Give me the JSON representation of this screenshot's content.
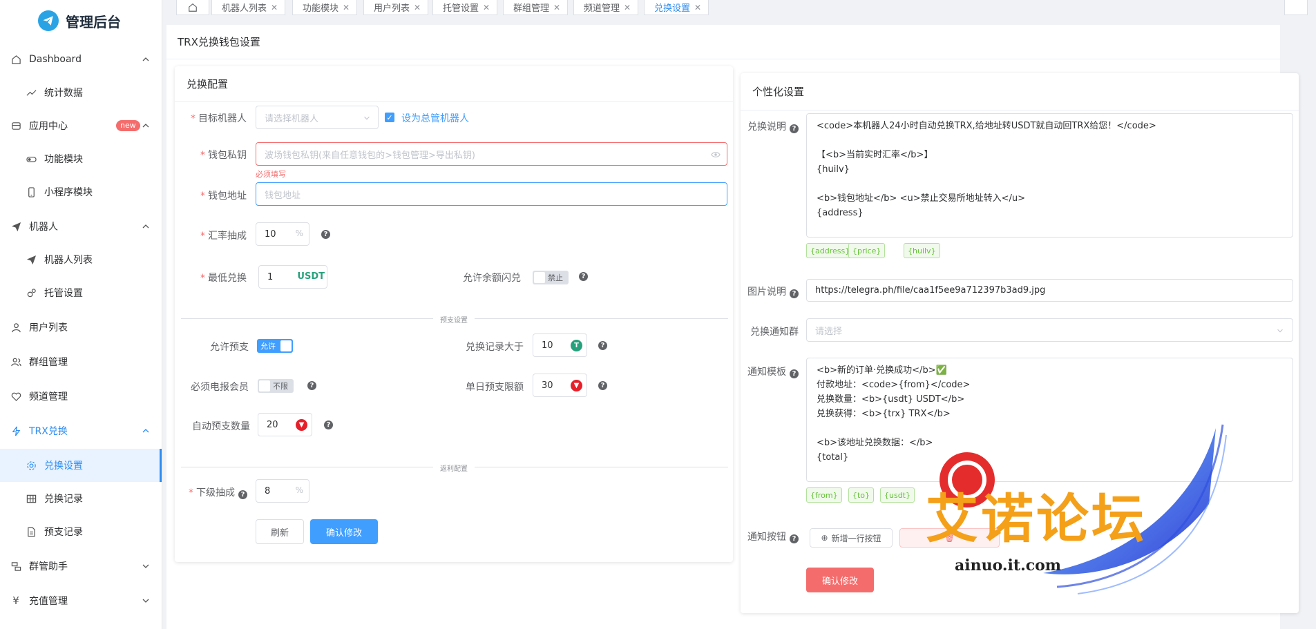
{
  "app": {
    "title": "管理后台"
  },
  "sidebar": {
    "items": [
      {
        "label": "Dashboard",
        "icon": "home-icon"
      },
      {
        "label": "统计数据",
        "icon": "trend-icon"
      },
      {
        "label": "应用中心",
        "icon": "app-center-icon",
        "badge": "new"
      },
      {
        "label": "功能模块",
        "icon": "toggle-icon"
      },
      {
        "label": "小程序模块",
        "icon": "phone-icon"
      },
      {
        "label": "机器人",
        "icon": "send-icon"
      },
      {
        "label": "机器人列表",
        "icon": "send-icon"
      },
      {
        "label": "托管设置",
        "icon": "gears-icon"
      },
      {
        "label": "用户列表",
        "icon": "user-icon"
      },
      {
        "label": "群组管理",
        "icon": "group-icon"
      },
      {
        "label": "频道管理",
        "icon": "heart-icon"
      },
      {
        "label": "TRX兑换",
        "icon": "bolt-icon"
      },
      {
        "label": "兑换设置",
        "icon": "gear-icon"
      },
      {
        "label": "兑换记录",
        "icon": "grid-icon"
      },
      {
        "label": "预支记录",
        "icon": "doc-icon"
      },
      {
        "label": "群管助手",
        "icon": "manage-icon"
      },
      {
        "label": "充值管理",
        "icon": "yen-icon"
      }
    ]
  },
  "tabs": [
    {
      "label": "机器人列表"
    },
    {
      "label": "功能模块"
    },
    {
      "label": "用户列表"
    },
    {
      "label": "托管设置"
    },
    {
      "label": "群组管理"
    },
    {
      "label": "频道管理"
    },
    {
      "label": "兑换设置",
      "active": true
    }
  ],
  "page": {
    "title": "TRX兑换钱包设置"
  },
  "left_card": {
    "title": "兑换配置",
    "target_bot": {
      "label": "目标机器人",
      "placeholder": "请选择机器人",
      "checkbox_label": "设为总管机器人"
    },
    "private_key": {
      "label": "钱包私钥",
      "placeholder": "波场钱包私钥(来自任意钱包的>钱包管理>导出私钥)",
      "error": "必须填写"
    },
    "address": {
      "label": "钱包地址",
      "placeholder": "钱包地址"
    },
    "rate_fee": {
      "label": "汇率抽成",
      "value": "10",
      "suffix": "%"
    },
    "min_exchange": {
      "label": "最低兑换",
      "value": "1",
      "suffix": "USDT"
    },
    "allow_flash": {
      "label": "允许余额闪兑",
      "switch_text": "禁止"
    },
    "divider1": "预支设置",
    "allow_advance": {
      "label": "允许预支",
      "switch_text": "允许"
    },
    "record_gt": {
      "label": "兑换记录大于",
      "value": "10"
    },
    "must_premium": {
      "label": "必须电报会员",
      "switch_text": "不限"
    },
    "daily_limit": {
      "label": "单日预支限额",
      "value": "30"
    },
    "auto_amount": {
      "label": "自动预支数量",
      "value": "20"
    },
    "divider2": "返利配置",
    "sub_fee": {
      "label": "下级抽成",
      "value": "8",
      "suffix": "%"
    },
    "refresh_btn": "刷新",
    "confirm_btn": "确认修改"
  },
  "right_card": {
    "title": "个性化设置",
    "exchange_desc": {
      "label": "兑换说明",
      "value": "<code>本机器人24小时自动兑换TRX,给地址转USDT就自动回TRX给您！</code>\n\n【<b>当前实时汇率</b>】\n{huilv}\n\n<b>钱包地址</b> <u>禁止交易所地址转入</u>\n{address}",
      "tags": [
        "{address}",
        "{price}",
        "{huilv}"
      ]
    },
    "image_desc": {
      "label": "图片说明",
      "value": "https://telegra.ph/file/caa1f5ee9a712397b3ad9.jpg"
    },
    "notify_group": {
      "label": "兑换通知群",
      "placeholder": "请选择"
    },
    "notify_template": {
      "label": "通知模板",
      "value": "<b>新的订单·兑换成功</b>✅\n付款地址：<code>{from}</code>\n兑换数量：<b>{usdt} USDT</b>\n兑换获得：<b>{trx} TRX</b>\n\n<b>该地址兑换数据：</b>\n{total}",
      "tags": [
        "{from}",
        "{to}",
        "{usdt}"
      ]
    },
    "notify_buttons": {
      "label": "通知按钮",
      "add_btn": "新增一行按钮"
    },
    "confirm_btn": "确认修改"
  },
  "watermark": {
    "text": "艾诺论坛",
    "sub": "ainuo.it.com"
  },
  "colors": {
    "primary": "#409eff",
    "danger": "#f56c6c",
    "success": "#67c23a",
    "usdt": "#26a17b",
    "trx": "#e5202b"
  }
}
